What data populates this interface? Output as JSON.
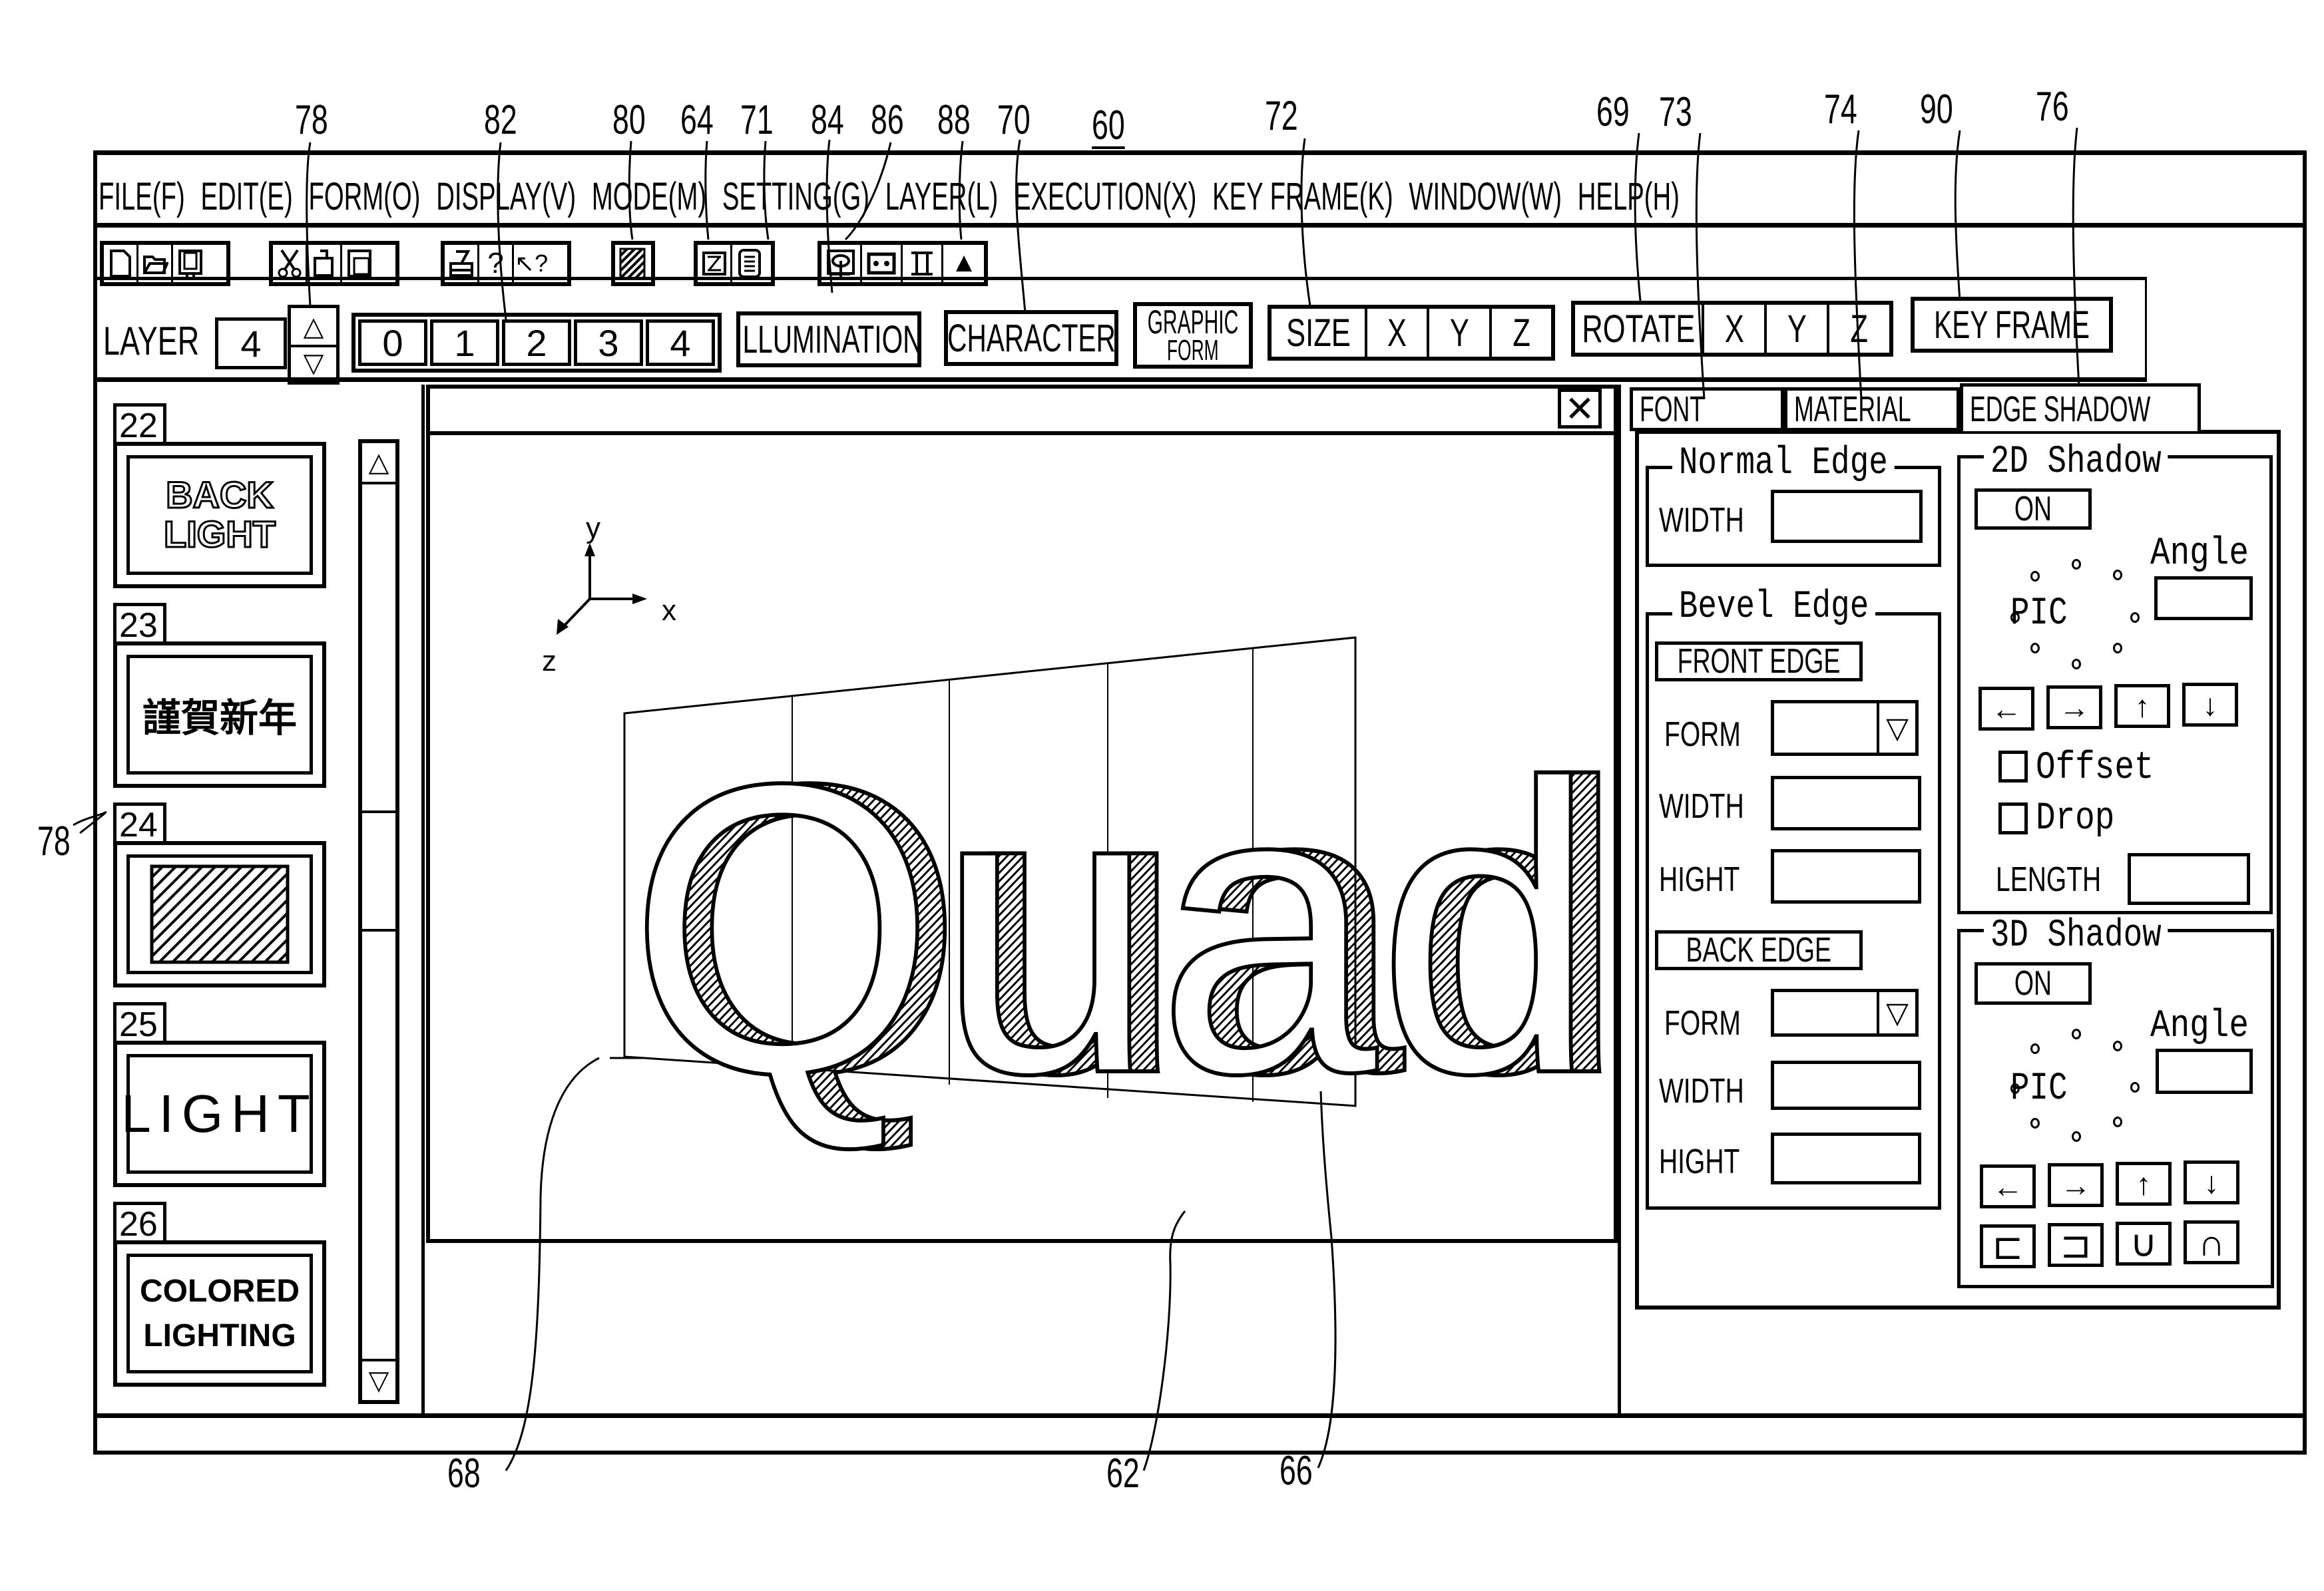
{
  "figure_refs": {
    "top": [
      "78",
      "82",
      "80",
      "64",
      "71",
      "84",
      "86",
      "88",
      "70",
      "60",
      "72",
      "69",
      "73",
      "74",
      "90",
      "76"
    ],
    "left": "78",
    "bottom": [
      "68",
      "62",
      "66"
    ]
  },
  "menu": {
    "items": [
      "FILE(F)",
      "EDIT(E)",
      "FORM(O)",
      "DISPLAY(V)",
      "MODE(M)",
      "SETTING(G)",
      "LAYER(L)",
      "EXECUTION(X)",
      "KEY FRAME(K)",
      "WINDOW(W)",
      "HELP(H)"
    ]
  },
  "toolbar": {
    "groups": [
      [
        "new-file-icon",
        "open-folder-icon",
        "save-icon"
      ],
      [
        "cut-scissors-icon",
        "copy-icon",
        "paste-icon"
      ],
      [
        "print-icon",
        "help-icon",
        "context-help-icon"
      ],
      [
        "pattern-icon"
      ],
      [
        "edit-frame-icon",
        "document-list-icon"
      ],
      [
        "illumination-icon",
        "camera-icon",
        "character-icon",
        "graphic-triangle-icon"
      ]
    ]
  },
  "layer_bar": {
    "layer_label": "LAYER",
    "layer_value": "4",
    "spin_up": "△",
    "spin_down": "▽",
    "layer_tabs": [
      "0",
      "1",
      "2",
      "3",
      "4"
    ],
    "illumination": "ILLUMINATION",
    "character": "CHARACTER",
    "graphic_form_line1": "GRAPHIC",
    "graphic_form_line2": "FORM",
    "size": {
      "label": "SIZE",
      "axes": [
        "X",
        "Y",
        "Z"
      ]
    },
    "rotate": {
      "label": "ROTATE",
      "axes": [
        "X",
        "Y",
        "Z"
      ]
    },
    "key_frame": "KEY FRAME"
  },
  "thumbnails": [
    {
      "number": "22",
      "line1": "BACK",
      "line2": "LIGHT"
    },
    {
      "number": "23",
      "line1": "謹賀新年",
      "line2": ""
    },
    {
      "number": "24",
      "line1": "",
      "line2": ""
    },
    {
      "number": "25",
      "line1": "LIGHT",
      "line2": ""
    },
    {
      "number": "26",
      "line1": "COLORED",
      "line2": "LIGHTING"
    }
  ],
  "scroll": {
    "up": "△",
    "down": "▽"
  },
  "canvas": {
    "close": "✕",
    "axis_x": "x",
    "axis_y": "y",
    "axis_z": "z",
    "text": "Quad"
  },
  "tabs": [
    {
      "label": "FONT",
      "active": false
    },
    {
      "label": "MATERIAL",
      "active": false
    },
    {
      "label": "EDGE SHADOW",
      "active": true
    }
  ],
  "edge_panel": {
    "normal_edge": {
      "title": "Normal Edge",
      "width_label": "WIDTH",
      "width_value": ""
    },
    "bevel_edge": {
      "title": "Bevel Edge",
      "front_edge": "FRONT EDGE",
      "back_edge": "BACK EDGE",
      "form_label": "FORM",
      "width_label": "WIDTH",
      "hight_label": "HIGHT",
      "dropdown_arrow": "▽"
    },
    "shadow_2d": {
      "title": "2D Shadow",
      "on": "ON",
      "angle": "Angle",
      "pic": "PIC",
      "arrows": [
        "←",
        "→",
        "↑",
        "↓"
      ],
      "offset": "Offset",
      "drop": "Drop",
      "length": "LENGTH",
      "offset_checked": false,
      "drop_checked": false
    },
    "shadow_3d": {
      "title": "3D Shadow",
      "on": "ON",
      "angle": "Angle",
      "pic": "PIC",
      "arrows": [
        "←",
        "→",
        "↑",
        "↓"
      ],
      "shapes": [
        "⊏",
        "⊐",
        "∪",
        "∩"
      ]
    }
  }
}
